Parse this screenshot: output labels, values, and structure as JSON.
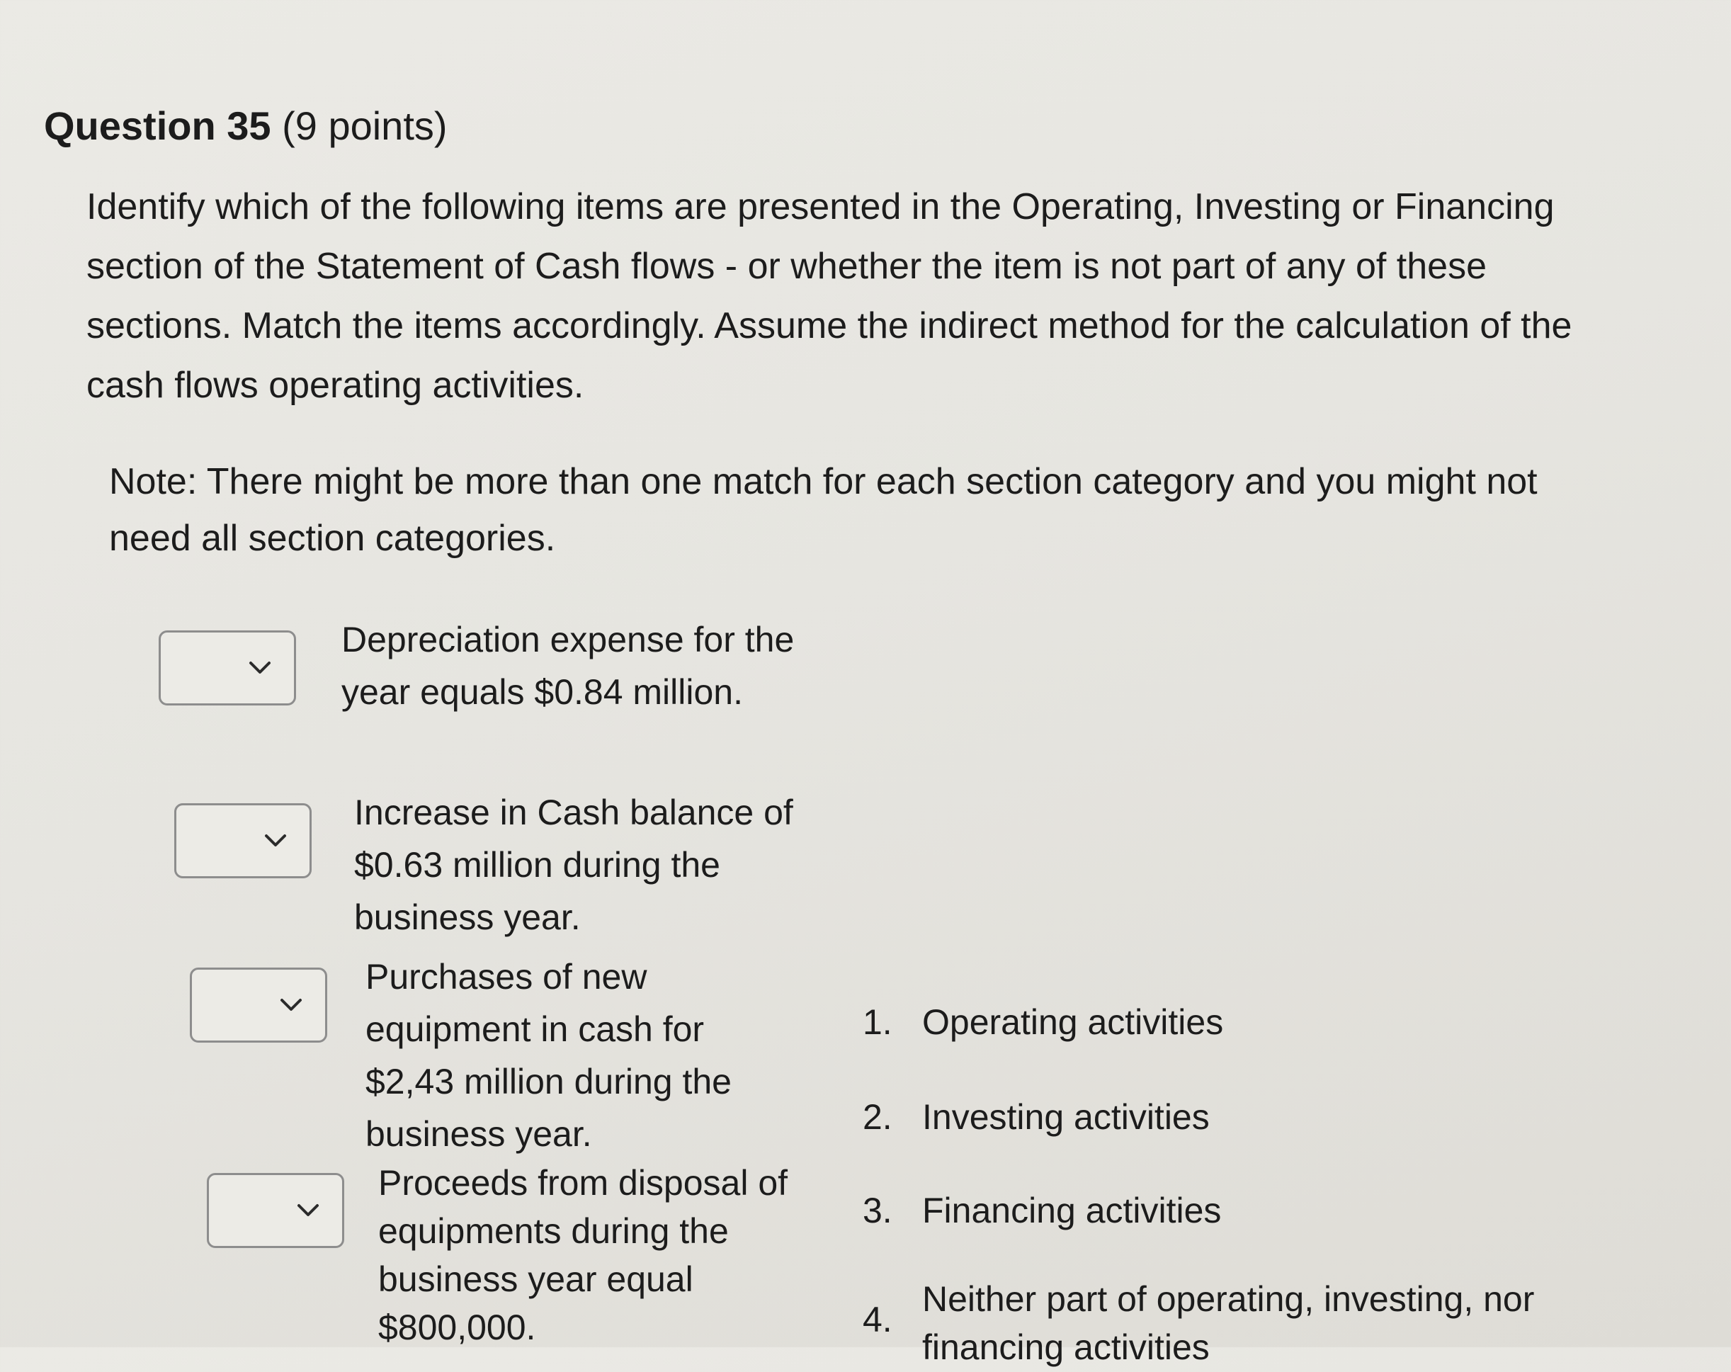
{
  "question": {
    "title": "Question 35",
    "points": "(9 points)"
  },
  "instructions": "Identify which of the following items are presented in the Operating, Investing or Financing section of the Statement of Cash flows - or whether the item is not part of any of these sections. Match the items accordingly. Assume the indirect method for the calculation of the cash flows operating activities.",
  "note": "Note: There might be more than one match for each section category and you might not need all section categories.",
  "items": [
    {
      "text": "Depreciation expense for the year equals $0.84 million.",
      "selected": ""
    },
    {
      "text": "Increase in Cash balance of $0.63 million during the business year.",
      "selected": ""
    },
    {
      "text": "Purchases of new equipment in cash for $2,43 million during the business year.",
      "selected": ""
    },
    {
      "text": "Proceeds from disposal of equipments during the business year equal $800,000.",
      "selected": ""
    }
  ],
  "answers": [
    {
      "num": "1.",
      "label": "Operating activities"
    },
    {
      "num": "2.",
      "label": "Investing activities"
    },
    {
      "num": "3.",
      "label": "Financing activities"
    },
    {
      "num": "4.",
      "label": "Neither part of operating, investing, nor financing activities"
    }
  ],
  "icons": {
    "dropdown": "chevron-down-icon"
  }
}
